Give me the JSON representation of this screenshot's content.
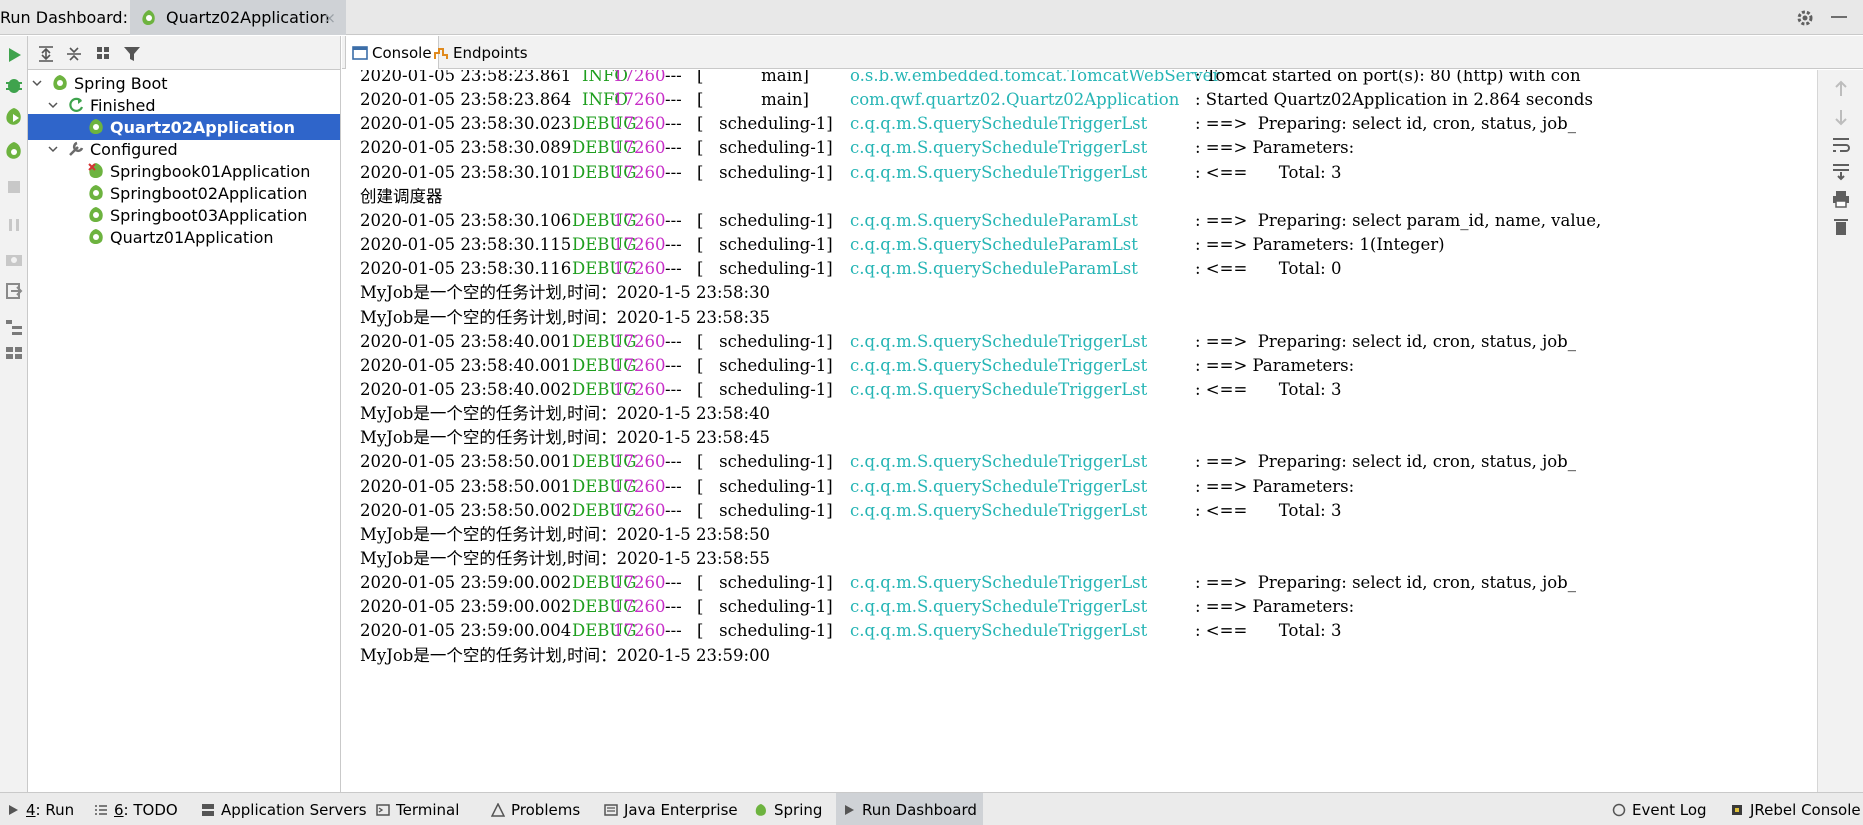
{
  "title_bar": {
    "label": "Run Dashboard:",
    "tab_label": "Quartz02Application",
    "close_glyph": "×"
  },
  "tree": {
    "root": "Spring Boot",
    "groups": [
      {
        "label": "Finished",
        "items": [
          "Quartz02Application"
        ]
      },
      {
        "label": "Configured",
        "items": [
          "Springbook01Application",
          "Springboot02Application",
          "Springboot03Application",
          "Quartz01Application"
        ]
      }
    ],
    "selected": "Quartz02Application"
  },
  "console_tabs": {
    "console": "Console",
    "endpoints": "Endpoints"
  },
  "console_lines": [
    {
      "ts": "2020-01-05 23:58:23.861",
      "level": "INFO",
      "pid": "17260",
      "sep": "---",
      "thread": "[           main]",
      "logger": "o.s.b.w.embedded.tomcat.TomcatWebServer",
      "msg": ": Tomcat started on port(s): 80 (http) with con"
    },
    {
      "ts": "2020-01-05 23:58:23.864",
      "level": "INFO",
      "pid": "17260",
      "sep": "---",
      "thread": "[           main]",
      "logger": "com.qwf.quartz02.Quartz02Application",
      "msg": ": Started Quartz02Application in 2.864 seconds"
    },
    {
      "ts": "2020-01-05 23:58:30.023",
      "level": "DEBUG",
      "pid": "17260",
      "sep": "---",
      "thread": "[   scheduling-1]",
      "logger": "c.q.q.m.S.queryScheduleTriggerLst",
      "msg": ": ==>  Preparing: select id, cron, status, job_"
    },
    {
      "ts": "2020-01-05 23:58:30.089",
      "level": "DEBUG",
      "pid": "17260",
      "sep": "---",
      "thread": "[   scheduling-1]",
      "logger": "c.q.q.m.S.queryScheduleTriggerLst",
      "msg": ": ==> Parameters:"
    },
    {
      "ts": "2020-01-05 23:58:30.101",
      "level": "DEBUG",
      "pid": "17260",
      "sep": "---",
      "thread": "[   scheduling-1]",
      "logger": "c.q.q.m.S.queryScheduleTriggerLst",
      "msg": ": <==      Total: 3"
    },
    {
      "plain": "创建调度器"
    },
    {
      "ts": "2020-01-05 23:58:30.106",
      "level": "DEBUG",
      "pid": "17260",
      "sep": "---",
      "thread": "[   scheduling-1]",
      "logger": "c.q.q.m.S.queryScheduleParamLst",
      "msg": ": ==>  Preparing: select param_id, name, value,"
    },
    {
      "ts": "2020-01-05 23:58:30.115",
      "level": "DEBUG",
      "pid": "17260",
      "sep": "---",
      "thread": "[   scheduling-1]",
      "logger": "c.q.q.m.S.queryScheduleParamLst",
      "msg": ": ==> Parameters: 1(Integer)"
    },
    {
      "ts": "2020-01-05 23:58:30.116",
      "level": "DEBUG",
      "pid": "17260",
      "sep": "---",
      "thread": "[   scheduling-1]",
      "logger": "c.q.q.m.S.queryScheduleParamLst",
      "msg": ": <==      Total: 0"
    },
    {
      "plain": "MyJob是一个空的任务计划,时间：2020-1-5 23:58:30"
    },
    {
      "plain": "MyJob是一个空的任务计划,时间：2020-1-5 23:58:35"
    },
    {
      "ts": "2020-01-05 23:58:40.001",
      "level": "DEBUG",
      "pid": "17260",
      "sep": "---",
      "thread": "[   scheduling-1]",
      "logger": "c.q.q.m.S.queryScheduleTriggerLst",
      "msg": ": ==>  Preparing: select id, cron, status, job_"
    },
    {
      "ts": "2020-01-05 23:58:40.001",
      "level": "DEBUG",
      "pid": "17260",
      "sep": "---",
      "thread": "[   scheduling-1]",
      "logger": "c.q.q.m.S.queryScheduleTriggerLst",
      "msg": ": ==> Parameters:"
    },
    {
      "ts": "2020-01-05 23:58:40.002",
      "level": "DEBUG",
      "pid": "17260",
      "sep": "---",
      "thread": "[   scheduling-1]",
      "logger": "c.q.q.m.S.queryScheduleTriggerLst",
      "msg": ": <==      Total: 3"
    },
    {
      "plain": "MyJob是一个空的任务计划,时间：2020-1-5 23:58:40"
    },
    {
      "plain": "MyJob是一个空的任务计划,时间：2020-1-5 23:58:45"
    },
    {
      "ts": "2020-01-05 23:58:50.001",
      "level": "DEBUG",
      "pid": "17260",
      "sep": "---",
      "thread": "[   scheduling-1]",
      "logger": "c.q.q.m.S.queryScheduleTriggerLst",
      "msg": ": ==>  Preparing: select id, cron, status, job_"
    },
    {
      "ts": "2020-01-05 23:58:50.001",
      "level": "DEBUG",
      "pid": "17260",
      "sep": "---",
      "thread": "[   scheduling-1]",
      "logger": "c.q.q.m.S.queryScheduleTriggerLst",
      "msg": ": ==> Parameters:"
    },
    {
      "ts": "2020-01-05 23:58:50.002",
      "level": "DEBUG",
      "pid": "17260",
      "sep": "---",
      "thread": "[   scheduling-1]",
      "logger": "c.q.q.m.S.queryScheduleTriggerLst",
      "msg": ": <==      Total: 3"
    },
    {
      "plain": "MyJob是一个空的任务计划,时间：2020-1-5 23:58:50"
    },
    {
      "plain": "MyJob是一个空的任务计划,时间：2020-1-5 23:58:55"
    },
    {
      "ts": "2020-01-05 23:59:00.002",
      "level": "DEBUG",
      "pid": "17260",
      "sep": "---",
      "thread": "[   scheduling-1]",
      "logger": "c.q.q.m.S.queryScheduleTriggerLst",
      "msg": ": ==>  Preparing: select id, cron, status, job_"
    },
    {
      "ts": "2020-01-05 23:59:00.002",
      "level": "DEBUG",
      "pid": "17260",
      "sep": "---",
      "thread": "[   scheduling-1]",
      "logger": "c.q.q.m.S.queryScheduleTriggerLst",
      "msg": ": ==> Parameters:"
    },
    {
      "ts": "2020-01-05 23:59:00.004",
      "level": "DEBUG",
      "pid": "17260",
      "sep": "---",
      "thread": "[   scheduling-1]",
      "logger": "c.q.q.m.S.queryScheduleTriggerLst",
      "msg": ": <==      Total: 3"
    },
    {
      "plain": "MyJob是一个空的任务计划,时间：2020-1-5 23:59:00"
    }
  ],
  "bottom_bar": [
    {
      "key": "4",
      "label": ": Run",
      "icon": "run-icon"
    },
    {
      "key": "6",
      "label": ": TODO",
      "icon": "todo-icon"
    },
    {
      "key": "",
      "label": "Application Servers",
      "icon": "app-servers-icon"
    },
    {
      "key": "",
      "label": "Terminal",
      "icon": "terminal-icon"
    },
    {
      "key": "",
      "label": "Problems",
      "icon": "problems-icon"
    },
    {
      "key": "",
      "label": "Java Enterprise",
      "icon": "java-enterprise-icon"
    },
    {
      "key": "",
      "label": "Spring",
      "icon": "spring-icon"
    },
    {
      "key": "",
      "label": "Run Dashboard",
      "icon": "run-dashboard-icon"
    },
    {
      "key": "",
      "label": "Event Log",
      "icon": "event-log-icon"
    },
    {
      "key": "",
      "label": "JRebel Console",
      "icon": "jrebel-icon"
    }
  ],
  "colors": {
    "selection": "#2f65ca",
    "log_level": "#1e9e1e",
    "pid": "#c72ec7",
    "logger": "#26b5b5",
    "spring_green": "#6db33f"
  }
}
